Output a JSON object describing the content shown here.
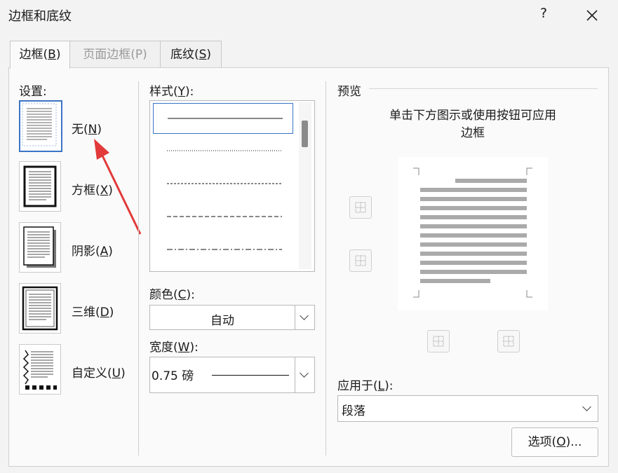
{
  "window": {
    "title": "边框和底纹",
    "help": "?"
  },
  "tabs": [
    {
      "label": "边框(B)",
      "pre": "边框(",
      "key": "B",
      "post": ")"
    },
    {
      "label": "页面边框(P)",
      "pre": "页面边框(",
      "key": "P",
      "post": ")"
    },
    {
      "label": "底纹(S)",
      "pre": "底纹(",
      "key": "S",
      "post": ")"
    }
  ],
  "settings": {
    "heading": "设置:",
    "items": [
      {
        "pre": "无(",
        "key": "N",
        "post": ")",
        "icon": "no-border-icon",
        "selected": true
      },
      {
        "pre": "方框(",
        "key": "X",
        "post": ")",
        "icon": "box-border-icon"
      },
      {
        "pre": "阴影(",
        "key": "A",
        "post": ")",
        "icon": "shadow-border-icon"
      },
      {
        "pre": "三维(",
        "key": "D",
        "post": ")",
        "icon": "3d-border-icon"
      },
      {
        "pre": "自定义(",
        "key": "U",
        "post": ")",
        "icon": "custom-border-icon"
      }
    ]
  },
  "style": {
    "pre": "样式(",
    "key": "Y",
    "post": "):"
  },
  "color": {
    "pre": "颜色(",
    "key": "C",
    "post": "):",
    "value": "自动"
  },
  "width": {
    "pre": "宽度(",
    "key": "W",
    "post": "):",
    "value": "0.75 磅"
  },
  "preview": {
    "heading": "预览",
    "instruction_line1": "单击下方图示或使用按钮可应用",
    "instruction_line2": "边框"
  },
  "apply_to": {
    "pre": "应用于(",
    "key": "L",
    "post": "):",
    "value": "段落"
  },
  "options_button": {
    "pre": "选项(",
    "key": "O",
    "post": ")..."
  }
}
